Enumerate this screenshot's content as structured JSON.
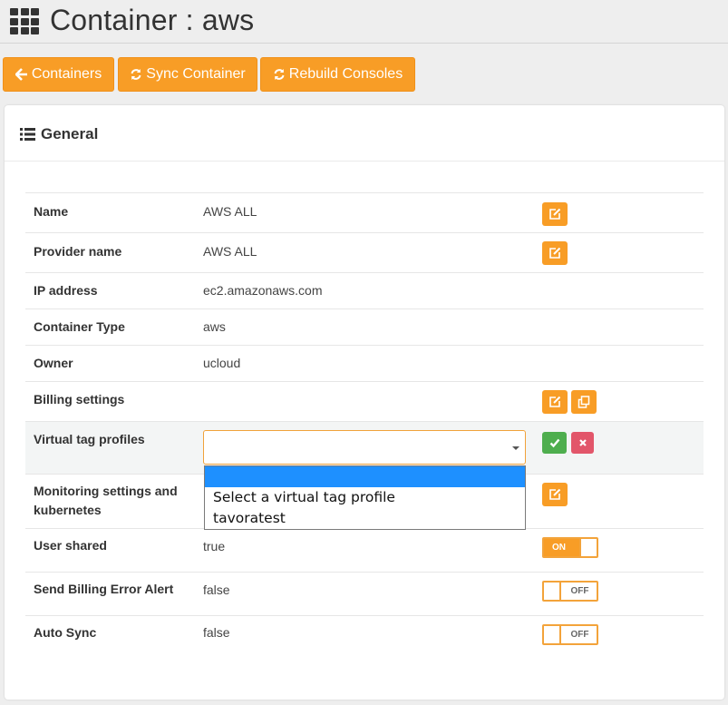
{
  "header": {
    "title": "Container : aws"
  },
  "toolbar": {
    "containers_label": "Containers",
    "sync_label": "Sync Container",
    "rebuild_label": "Rebuild Consoles"
  },
  "panel": {
    "title": "General"
  },
  "rows": {
    "name": {
      "label": "Name",
      "value": "AWS ALL"
    },
    "provider": {
      "label": "Provider name",
      "value": "AWS ALL"
    },
    "ip": {
      "label": "IP address",
      "value": "ec2.amazonaws.com"
    },
    "type": {
      "label": "Container Type",
      "value": "aws"
    },
    "owner": {
      "label": "Owner",
      "value": "ucloud"
    },
    "billing": {
      "label": "Billing settings"
    },
    "vtag": {
      "label": "Virtual tag profiles",
      "selected_value": ""
    },
    "monitoring": {
      "label_line1": "Monitoring settings and",
      "label_line2": "kubernetes"
    },
    "user_shared": {
      "label": "User shared",
      "value": "true",
      "toggle_on": true,
      "toggle_text": "ON"
    },
    "billing_alert": {
      "label": "Send Billing Error Alert",
      "value": "false",
      "toggle_on": false,
      "toggle_text": "OFF"
    },
    "auto_sync": {
      "label": "Auto Sync",
      "value": "false",
      "toggle_on": false,
      "toggle_text": "OFF"
    }
  },
  "dropdown": {
    "options": [
      "",
      "Select a virtual tag profile",
      "tavoratest"
    ],
    "highlighted_index": 0
  },
  "colors": {
    "accent": "#f89d26",
    "confirm": "#4eae4e",
    "cancel": "#e2566a",
    "dropdown_highlight": "#1e90ff"
  },
  "icons": {
    "header": "apps-grid-icon",
    "containers_button": "arrow-left-icon",
    "sync_button": "refresh-icon",
    "rebuild_button": "refresh-icon",
    "panel": "list-icon",
    "edit": "edit-icon",
    "copy": "copy-icon",
    "confirm": "check-icon",
    "cancel": "close-icon"
  }
}
